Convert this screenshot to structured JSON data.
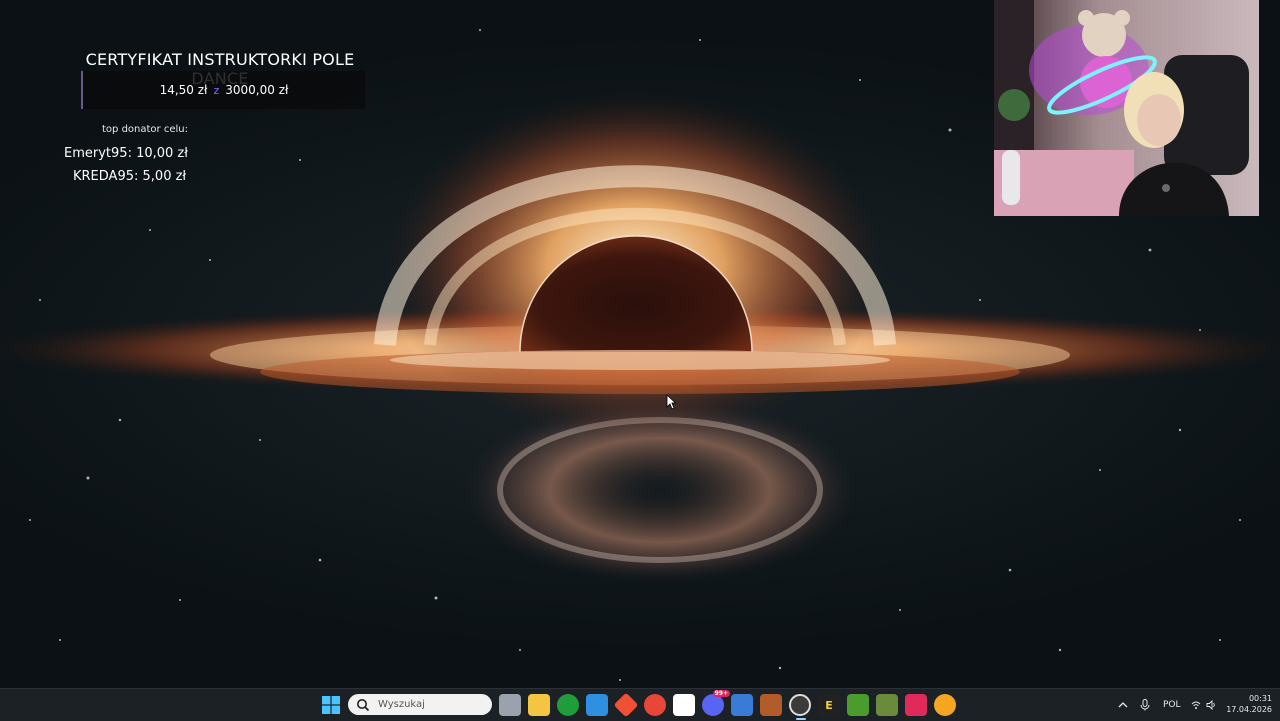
{
  "overlay": {
    "goal_title": "CERTYFIKAT INSTRUKTORKI POLE DANCE",
    "current": "14,50 zł",
    "separator": "z",
    "target": "3000,00 zł",
    "progress_fraction": 0.0048,
    "top_donor_label": "top donator celu:",
    "donors": [
      {
        "name": "Emeryt95",
        "amount": "10,00 zł"
      },
      {
        "name": "KREDA95",
        "amount": "5,00 zł"
      }
    ]
  },
  "taskbar": {
    "search_placeholder": "Wyszukaj",
    "apps": [
      {
        "name": "task-view-icon",
        "color": "#9aa3ad"
      },
      {
        "name": "file-explorer-icon",
        "color": "#f4c542"
      },
      {
        "name": "xbox-icon",
        "color": "#1f9d3a"
      },
      {
        "name": "vscode-icon",
        "color": "#2f8fe0"
      },
      {
        "name": "git-app-icon",
        "color": "#f05033"
      },
      {
        "name": "chrome-icon",
        "color": "#e9463a"
      },
      {
        "name": "app-black-white-icon",
        "color": "#ffffff"
      },
      {
        "name": "discord-icon",
        "color": "#5865f2",
        "badge": "99+"
      },
      {
        "name": "notepad-icon",
        "color": "#3a7bd5"
      },
      {
        "name": "game-app-icon",
        "color": "#b25b2b"
      },
      {
        "name": "obs-icon",
        "color": "#3b3b3b"
      },
      {
        "name": "epic-games-icon",
        "color": "#222222",
        "glyph": "E"
      },
      {
        "name": "minecraft-icon",
        "color": "#4b9b2d"
      },
      {
        "name": "minecraft-launcher-icon",
        "color": "#6a8b3c"
      },
      {
        "name": "tiktok-icon",
        "color": "#e02a5a"
      },
      {
        "name": "chrome-canary-icon",
        "color": "#f4a623"
      }
    ],
    "tray": {
      "language": "POL",
      "time": "00:31",
      "date": "17.04.2026"
    }
  }
}
